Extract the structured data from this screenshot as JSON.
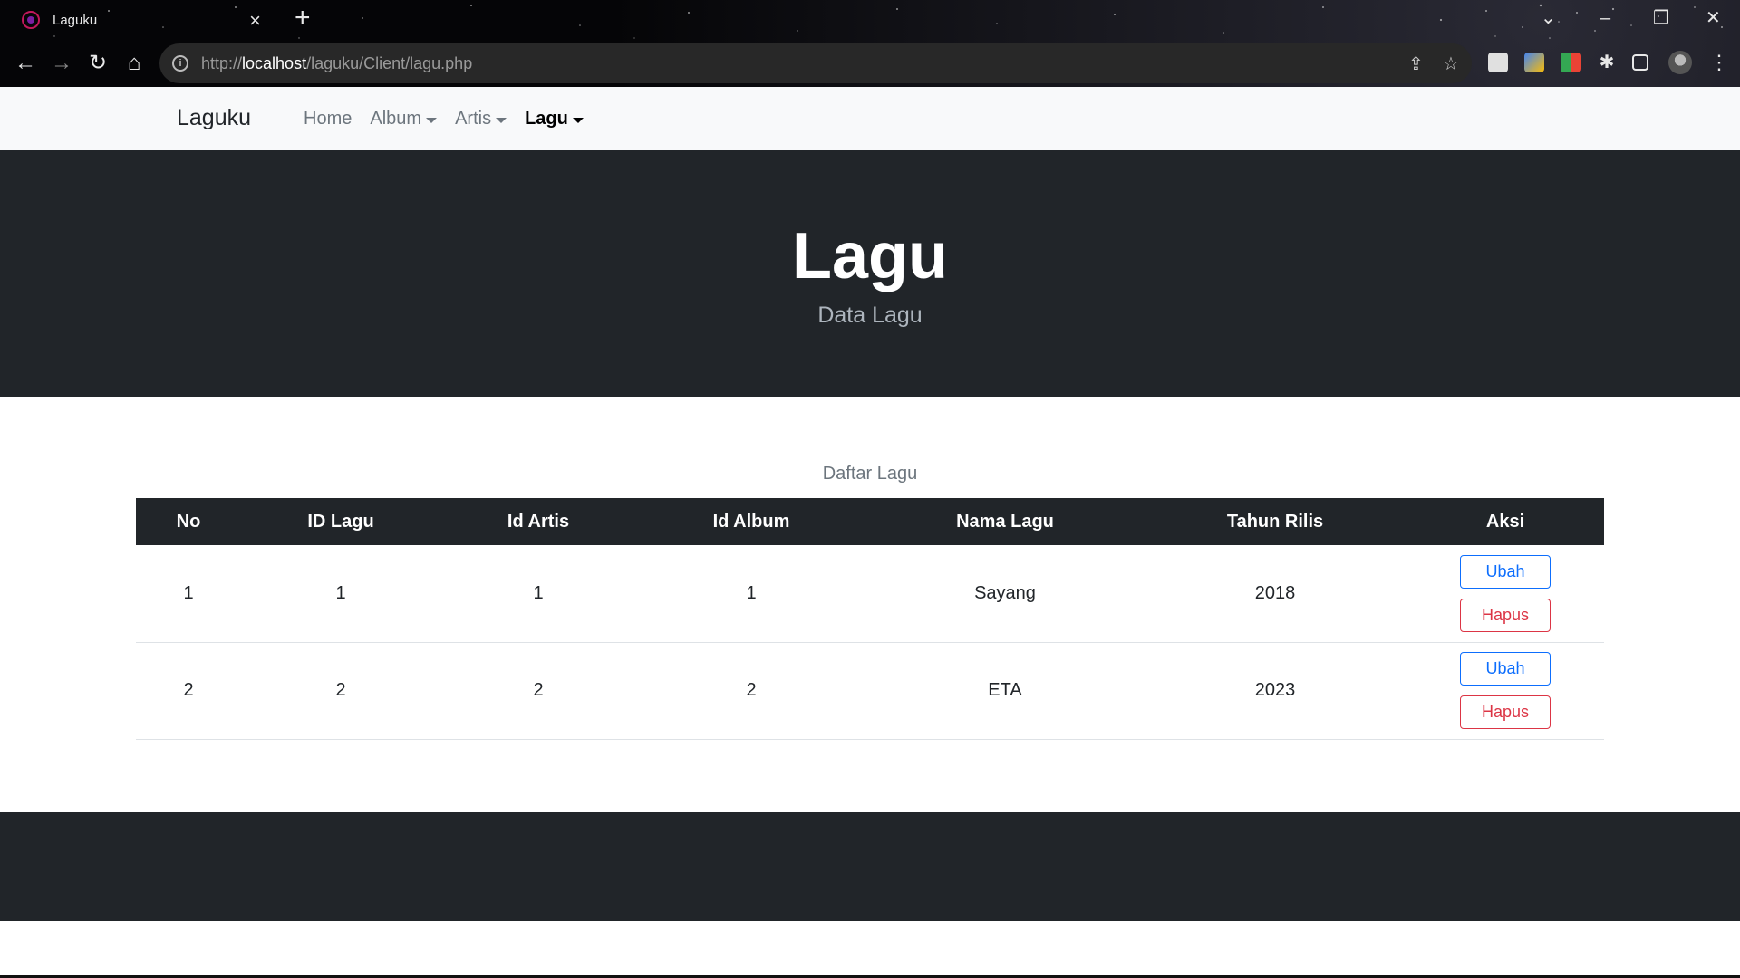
{
  "browser": {
    "tab_title": "Laguku",
    "url_prefix": "http://",
    "url_host": "localhost",
    "url_path": "/laguku/Client/lagu.php"
  },
  "navbar": {
    "brand": "Laguku",
    "links": [
      {
        "label": "Home",
        "dropdown": false,
        "active": false
      },
      {
        "label": "Album",
        "dropdown": true,
        "active": false
      },
      {
        "label": "Artis",
        "dropdown": true,
        "active": false
      },
      {
        "label": "Lagu",
        "dropdown": true,
        "active": true
      }
    ]
  },
  "hero": {
    "title": "Lagu",
    "subtitle": "Data Lagu"
  },
  "table": {
    "caption": "Daftar Lagu",
    "headers": [
      "No",
      "ID Lagu",
      "Id Artis",
      "Id Album",
      "Nama Lagu",
      "Tahun Rilis",
      "Aksi"
    ],
    "rows": [
      {
        "no": "1",
        "id_lagu": "1",
        "id_artis": "1",
        "id_album": "1",
        "nama_lagu": "Sayang",
        "tahun_rilis": "2018",
        "edit_label": "Ubah",
        "delete_label": "Hapus"
      },
      {
        "no": "2",
        "id_lagu": "2",
        "id_artis": "2",
        "id_album": "2",
        "nama_lagu": "ETA",
        "tahun_rilis": "2023",
        "edit_label": "Ubah",
        "delete_label": "Hapus"
      }
    ]
  },
  "colors": {
    "dark": "#212529",
    "navbar_bg": "#f8f9fa",
    "primary": "#0d6efd",
    "danger": "#dc3545"
  }
}
